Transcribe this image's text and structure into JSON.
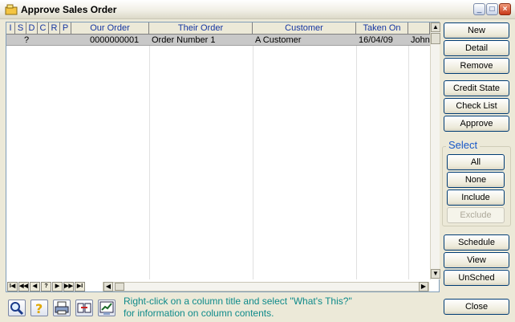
{
  "window": {
    "title": "Approve Sales Order"
  },
  "grid": {
    "columns": [
      "I",
      "S",
      "D",
      "C",
      "R",
      "P",
      "Our Order",
      "Their Order",
      "Customer",
      "Taken On",
      ""
    ],
    "rows": [
      {
        "s": "?",
        "our_order": "0000000001",
        "their_order": "Order Number 1",
        "customer": "A Customer",
        "taken_on": "16/04/09",
        "extra": "John"
      }
    ],
    "nav": [
      "I◀",
      "◀◀",
      "◀",
      "?",
      "▶",
      "▶▶",
      "▶I"
    ]
  },
  "buttons": {
    "new": "New",
    "detail": "Detail",
    "remove": "Remove",
    "credit_state": "Credit State",
    "check_list": "Check List",
    "approve": "Approve",
    "schedule": "Schedule",
    "view": "View",
    "unsched": "UnSched",
    "close": "Close"
  },
  "select": {
    "legend": "Select",
    "all": "All",
    "none": "None",
    "include": "Include",
    "exclude": "Exclude"
  },
  "hint": {
    "line1": "Right-click on a column title and select \"What's This?\"",
    "line2": "for information on column contents."
  },
  "colors": {
    "accent": "#1757c8",
    "hint": "#0e8a8a",
    "header_text": "#1535a0"
  },
  "icons": [
    "app-icon",
    "search-icon",
    "help-icon",
    "print-icon",
    "swap-icon",
    "chart-icon"
  ]
}
